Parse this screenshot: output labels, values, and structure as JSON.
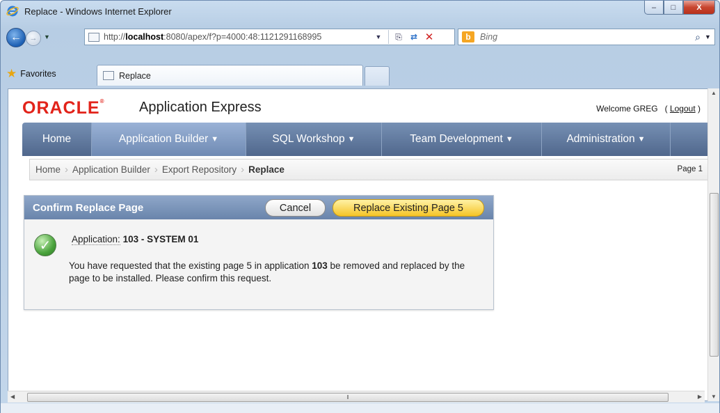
{
  "window": {
    "title": "Replace - Windows Internet Explorer",
    "controls": {
      "minimize": "–",
      "maximize": "□",
      "close": "X"
    }
  },
  "browser": {
    "url_prefix": "http://",
    "url_host": "localhost",
    "url_rest": ":8080/apex/f?p=4000:48:1121291168995",
    "search_placeholder": "Bing",
    "favorites_label": "Favorites",
    "tab_label": "Replace"
  },
  "apex": {
    "brand": "ORACLE",
    "product": "Application Express",
    "welcome": "Welcome GREG",
    "logout": "Logout",
    "nav_tabs": [
      {
        "label": "Home",
        "dropdown": false
      },
      {
        "label": "Application Builder",
        "dropdown": true,
        "active": true
      },
      {
        "label": "SQL Workshop",
        "dropdown": true
      },
      {
        "label": "Team Development",
        "dropdown": true
      },
      {
        "label": "Administration",
        "dropdown": true
      }
    ],
    "breadcrumbs": [
      "Home",
      "Application Builder",
      "Export Repository",
      "Replace"
    ],
    "page_indicator": "Page 1"
  },
  "region": {
    "title": "Confirm Replace Page",
    "cancel_label": "Cancel",
    "replace_label": "Replace Existing Page 5",
    "application_label": "Application:",
    "application_value": "103 - SYSTEM 01",
    "message_part1": "You have requested that the existing page 5 in application ",
    "message_bold": "103",
    "message_part2": " be removed and replaced by the page to be installed. Please confirm this request."
  },
  "colors": {
    "oracle_red": "#e2231a",
    "nav_bar": "#5e7699",
    "region_header": "#7a93b8",
    "replace_button": "#f5c427"
  }
}
